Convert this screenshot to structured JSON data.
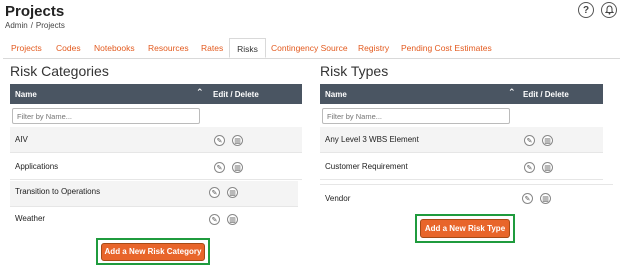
{
  "header": {
    "title": "Projects",
    "breadcrumb": [
      "Admin",
      "Projects"
    ],
    "breadcrumb_sep": "/",
    "help_glyph": "?",
    "bell_glyph": "🔔"
  },
  "tabs": [
    {
      "label": "Projects"
    },
    {
      "label": "Codes"
    },
    {
      "label": "Notebooks"
    },
    {
      "label": "Resources"
    },
    {
      "label": "Rates"
    },
    {
      "label": "Risks",
      "active": true
    },
    {
      "label": "Contingency Source"
    },
    {
      "label": "Registry"
    },
    {
      "label": "Pending Cost Estimates"
    }
  ],
  "risk_categories": {
    "title": "Risk Categories",
    "col_name": "Name",
    "col_actions": "Edit / Delete",
    "filter_placeholder": "Filter by Name...",
    "rows": [
      "AIV",
      "Applications",
      "Transition to Operations",
      "Weather"
    ],
    "add_button": "Add a New Risk Category"
  },
  "risk_types": {
    "title": "Risk Types",
    "col_name": "Name",
    "col_actions": "Edit / Delete",
    "filter_placeholder": "Filter by Name...",
    "rows": [
      "Any Level 3 WBS Element",
      "Customer Requirement",
      "Vendor"
    ],
    "add_button": "Add a New Risk Type"
  },
  "colors": {
    "accent": "#e35a1e",
    "header_bg": "#4a5562",
    "button_bg": "#e8652a",
    "highlight": "#1f9b3d"
  }
}
